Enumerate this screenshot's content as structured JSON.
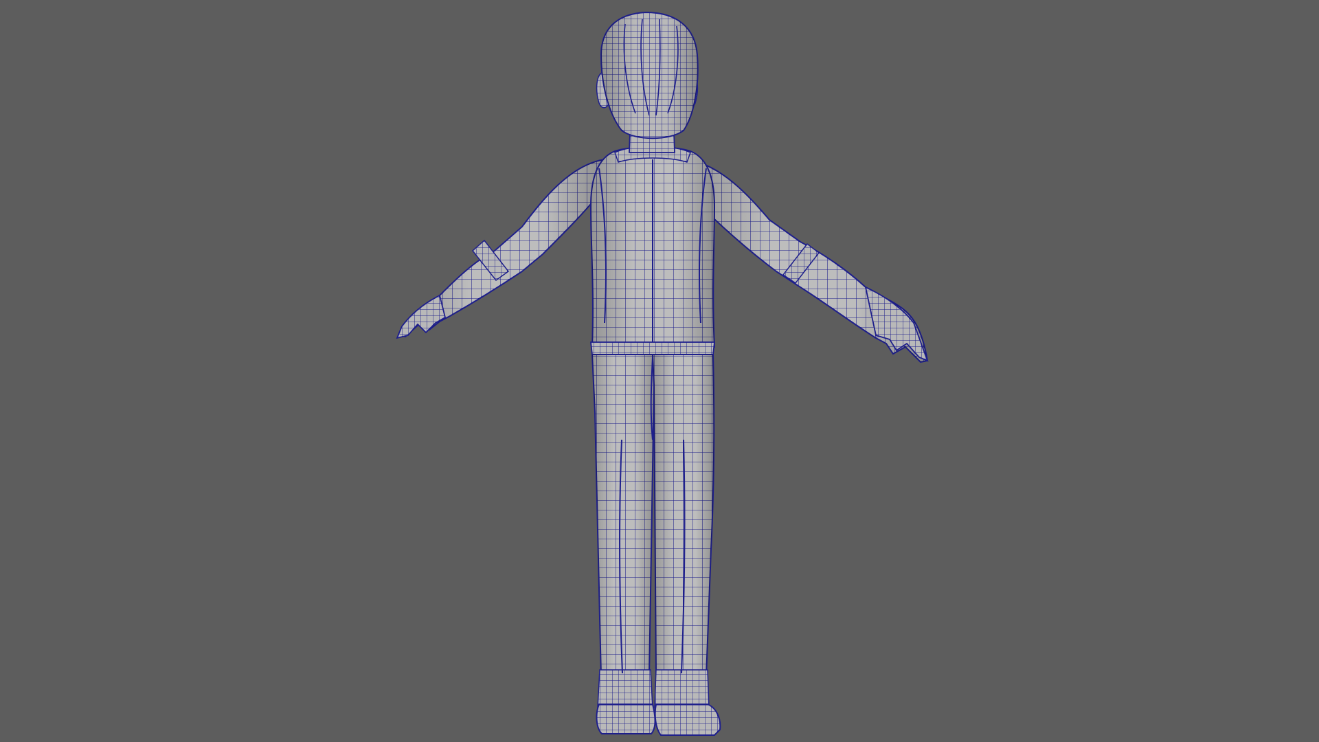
{
  "viewport": {
    "background_color": "#5d5d5d",
    "mesh_fill_color": "#bdbdbd",
    "wireframe_color": "#1e1f8c",
    "display_mode": "wireframe-on-shaded",
    "model_pose": "T-pose",
    "view": "back"
  }
}
